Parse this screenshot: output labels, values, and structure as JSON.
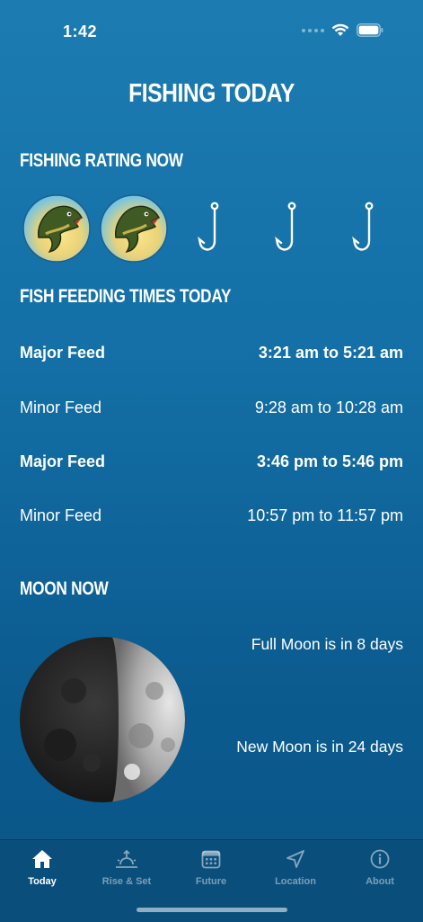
{
  "status_bar": {
    "time": "1:42"
  },
  "page_title": "FISHING TODAY",
  "rating": {
    "heading": "FISHING RATING NOW",
    "score": 2,
    "max": 5
  },
  "feeding": {
    "heading": "FISH FEEDING TIMES TODAY",
    "rows": [
      {
        "type": "Major Feed",
        "time": "3:21 am to 5:21 am",
        "major": true
      },
      {
        "type": "Minor Feed",
        "time": "9:28 am to 10:28 am",
        "major": false
      },
      {
        "type": "Major Feed",
        "time": "3:46 pm to 5:46 pm",
        "major": true
      },
      {
        "type": "Minor Feed",
        "time": "10:57 pm to 11:57 pm",
        "major": false
      }
    ]
  },
  "moon": {
    "heading": "MOON NOW",
    "full_moon": "Full Moon is in 8 days",
    "new_moon": "New Moon is in 24 days"
  },
  "tabs": [
    {
      "label": "Today",
      "icon": "home-icon",
      "active": true
    },
    {
      "label": "Rise & Set",
      "icon": "sunrise-icon",
      "active": false
    },
    {
      "label": "Future",
      "icon": "calendar-icon",
      "active": false
    },
    {
      "label": "Location",
      "icon": "location-arrow-icon",
      "active": false
    },
    {
      "label": "About",
      "icon": "info-icon",
      "active": false
    }
  ]
}
